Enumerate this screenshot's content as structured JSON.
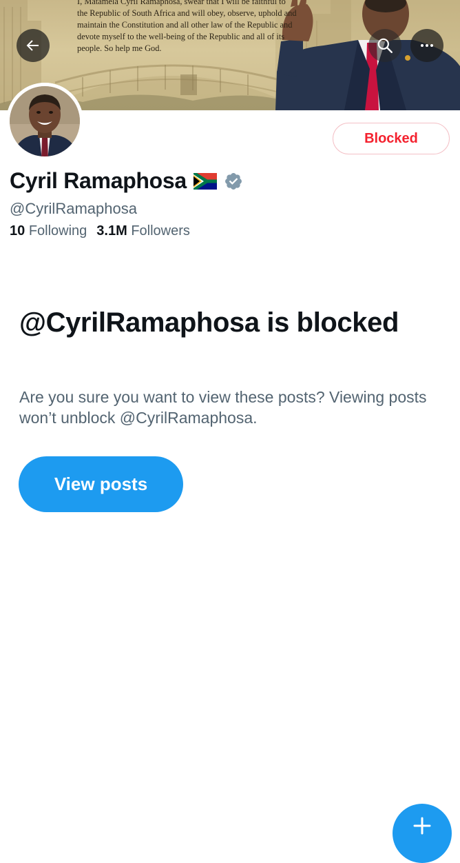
{
  "banner": {
    "oath_text": "I, Matamela Cyril Ramaphosa, swear that I will be faithful to the Republic of South Africa and will obey, observe, uphold and maintain the Constitution and all other law of the Republic and devote myself to the well-being of the Republic and all of its people. So help me God.",
    "icons": {
      "back": "arrow-left-icon",
      "search": "search-icon",
      "more": "more-horizontal-icon"
    }
  },
  "profile": {
    "display_name": "Cyril Ramaphosa",
    "flag_emoji": "south-africa-flag-icon",
    "verified_icon": "verified-badge-icon",
    "handle": "@CyrilRamaphosa",
    "following_count": "10",
    "following_label": "Following",
    "followers_count": "3.1M",
    "followers_label": "Followers",
    "blocked_button_label": "Blocked"
  },
  "blocked_notice": {
    "title": "@CyrilRamaphosa is blocked",
    "description": "Are you sure you want to view these posts? Viewing posts won’t unblock @CyrilRamaphosa.",
    "view_posts_label": "View posts"
  },
  "fab": {
    "icon": "compose-plus-icon"
  },
  "colors": {
    "accent": "#1d9bf0",
    "blocked_red": "#f4212e",
    "secondary_text": "#536471",
    "primary_text": "#0f1419",
    "verified_grey": "#829aab"
  }
}
